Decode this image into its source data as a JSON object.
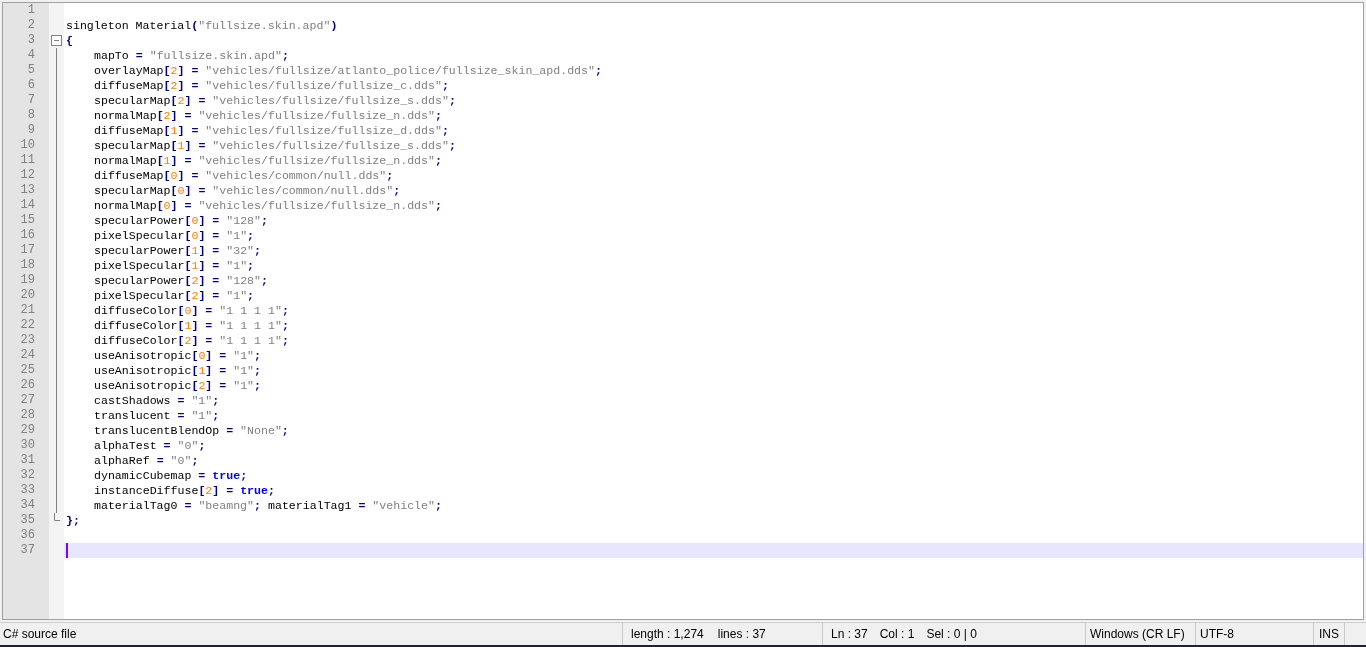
{
  "editor": {
    "lines": [
      {
        "number": "1",
        "kind": "plain",
        "current": false
      },
      {
        "number": "2",
        "kind": "plain",
        "current": false,
        "tokens": [
          {
            "kind": "ident",
            "text": "singleton Material"
          },
          {
            "kind": "op",
            "text": "("
          },
          {
            "kind": "str",
            "text": "\"fullsize.skin.apd\""
          },
          {
            "kind": "op",
            "text": ")"
          }
        ]
      },
      {
        "number": "3",
        "kind": "fold_start",
        "current": false,
        "tokens": [
          {
            "kind": "op",
            "text": "{"
          }
        ]
      },
      {
        "number": "4",
        "kind": "fold_body",
        "current": false,
        "tokens": [
          {
            "kind": "ident",
            "text": "mapTo"
          },
          {
            "kind": "op",
            "text": " = "
          },
          {
            "kind": "str",
            "text": "\"fullsize.skin.apd\""
          },
          {
            "kind": "op",
            "text": ";"
          }
        ]
      },
      {
        "number": "5",
        "kind": "fold_body",
        "current": false,
        "tokens": [
          {
            "kind": "ident",
            "text": "overlayMap"
          },
          {
            "kind": "op",
            "text": "["
          },
          {
            "kind": "num",
            "text": "2"
          },
          {
            "kind": "op",
            "text": "] = "
          },
          {
            "kind": "str",
            "text": "\"vehicles/fullsize/atlanto_police/fullsize_skin_apd.dds\""
          },
          {
            "kind": "op",
            "text": ";"
          }
        ]
      },
      {
        "number": "6",
        "kind": "fold_body",
        "current": false,
        "tokens": [
          {
            "kind": "ident",
            "text": "diffuseMap"
          },
          {
            "kind": "op",
            "text": "["
          },
          {
            "kind": "num",
            "text": "2"
          },
          {
            "kind": "op",
            "text": "] = "
          },
          {
            "kind": "str",
            "text": "\"vehicles/fullsize/fullsize_c.dds\""
          },
          {
            "kind": "op",
            "text": ";"
          }
        ]
      },
      {
        "number": "7",
        "kind": "fold_body",
        "current": false,
        "tokens": [
          {
            "kind": "ident",
            "text": "specularMap"
          },
          {
            "kind": "op",
            "text": "["
          },
          {
            "kind": "num",
            "text": "2"
          },
          {
            "kind": "op",
            "text": "] = "
          },
          {
            "kind": "str",
            "text": "\"vehicles/fullsize/fullsize_s.dds\""
          },
          {
            "kind": "op",
            "text": ";"
          }
        ]
      },
      {
        "number": "8",
        "kind": "fold_body",
        "current": false,
        "tokens": [
          {
            "kind": "ident",
            "text": "normalMap"
          },
          {
            "kind": "op",
            "text": "["
          },
          {
            "kind": "num",
            "text": "2"
          },
          {
            "kind": "op",
            "text": "] = "
          },
          {
            "kind": "str",
            "text": "\"vehicles/fullsize/fullsize_n.dds\""
          },
          {
            "kind": "op",
            "text": ";"
          }
        ]
      },
      {
        "number": "9",
        "kind": "fold_body",
        "current": false,
        "tokens": [
          {
            "kind": "ident",
            "text": "diffuseMap"
          },
          {
            "kind": "op",
            "text": "["
          },
          {
            "kind": "num",
            "text": "1"
          },
          {
            "kind": "op",
            "text": "] = "
          },
          {
            "kind": "str",
            "text": "\"vehicles/fullsize/fullsize_d.dds\""
          },
          {
            "kind": "op",
            "text": ";"
          }
        ]
      },
      {
        "number": "10",
        "kind": "fold_body",
        "current": false,
        "tokens": [
          {
            "kind": "ident",
            "text": "specularMap"
          },
          {
            "kind": "op",
            "text": "["
          },
          {
            "kind": "num",
            "text": "1"
          },
          {
            "kind": "op",
            "text": "] = "
          },
          {
            "kind": "str",
            "text": "\"vehicles/fullsize/fullsize_s.dds\""
          },
          {
            "kind": "op",
            "text": ";"
          }
        ]
      },
      {
        "number": "11",
        "kind": "fold_body",
        "current": false,
        "tokens": [
          {
            "kind": "ident",
            "text": "normalMap"
          },
          {
            "kind": "op",
            "text": "["
          },
          {
            "kind": "num",
            "text": "1"
          },
          {
            "kind": "op",
            "text": "] = "
          },
          {
            "kind": "str",
            "text": "\"vehicles/fullsize/fullsize_n.dds\""
          },
          {
            "kind": "op",
            "text": ";"
          }
        ]
      },
      {
        "number": "12",
        "kind": "fold_body",
        "current": false,
        "tokens": [
          {
            "kind": "ident",
            "text": "diffuseMap"
          },
          {
            "kind": "op",
            "text": "["
          },
          {
            "kind": "num",
            "text": "0"
          },
          {
            "kind": "op",
            "text": "] = "
          },
          {
            "kind": "str",
            "text": "\"vehicles/common/null.dds\""
          },
          {
            "kind": "op",
            "text": ";"
          }
        ]
      },
      {
        "number": "13",
        "kind": "fold_body",
        "current": false,
        "tokens": [
          {
            "kind": "ident",
            "text": "specularMap"
          },
          {
            "kind": "op",
            "text": "["
          },
          {
            "kind": "num",
            "text": "0"
          },
          {
            "kind": "op",
            "text": "] = "
          },
          {
            "kind": "str",
            "text": "\"vehicles/common/null.dds\""
          },
          {
            "kind": "op",
            "text": ";"
          }
        ]
      },
      {
        "number": "14",
        "kind": "fold_body",
        "current": false,
        "tokens": [
          {
            "kind": "ident",
            "text": "normalMap"
          },
          {
            "kind": "op",
            "text": "["
          },
          {
            "kind": "num",
            "text": "0"
          },
          {
            "kind": "op",
            "text": "] = "
          },
          {
            "kind": "str",
            "text": "\"vehicles/fullsize/fullsize_n.dds\""
          },
          {
            "kind": "op",
            "text": ";"
          }
        ]
      },
      {
        "number": "15",
        "kind": "fold_body",
        "current": false,
        "tokens": [
          {
            "kind": "ident",
            "text": "specularPower"
          },
          {
            "kind": "op",
            "text": "["
          },
          {
            "kind": "num",
            "text": "0"
          },
          {
            "kind": "op",
            "text": "] = "
          },
          {
            "kind": "str",
            "text": "\"128\""
          },
          {
            "kind": "op",
            "text": ";"
          }
        ]
      },
      {
        "number": "16",
        "kind": "fold_body",
        "current": false,
        "tokens": [
          {
            "kind": "ident",
            "text": "pixelSpecular"
          },
          {
            "kind": "op",
            "text": "["
          },
          {
            "kind": "num",
            "text": "0"
          },
          {
            "kind": "op",
            "text": "] = "
          },
          {
            "kind": "str",
            "text": "\"1\""
          },
          {
            "kind": "op",
            "text": ";"
          }
        ]
      },
      {
        "number": "17",
        "kind": "fold_body",
        "current": false,
        "tokens": [
          {
            "kind": "ident",
            "text": "specularPower"
          },
          {
            "kind": "op",
            "text": "["
          },
          {
            "kind": "num",
            "text": "1"
          },
          {
            "kind": "op",
            "text": "] = "
          },
          {
            "kind": "str",
            "text": "\"32\""
          },
          {
            "kind": "op",
            "text": ";"
          }
        ]
      },
      {
        "number": "18",
        "kind": "fold_body",
        "current": false,
        "tokens": [
          {
            "kind": "ident",
            "text": "pixelSpecular"
          },
          {
            "kind": "op",
            "text": "["
          },
          {
            "kind": "num",
            "text": "1"
          },
          {
            "kind": "op",
            "text": "] = "
          },
          {
            "kind": "str",
            "text": "\"1\""
          },
          {
            "kind": "op",
            "text": ";"
          }
        ]
      },
      {
        "number": "19",
        "kind": "fold_body",
        "current": false,
        "tokens": [
          {
            "kind": "ident",
            "text": "specularPower"
          },
          {
            "kind": "op",
            "text": "["
          },
          {
            "kind": "num",
            "text": "2"
          },
          {
            "kind": "op",
            "text": "] = "
          },
          {
            "kind": "str",
            "text": "\"128\""
          },
          {
            "kind": "op",
            "text": ";"
          }
        ]
      },
      {
        "number": "20",
        "kind": "fold_body",
        "current": false,
        "tokens": [
          {
            "kind": "ident",
            "text": "pixelSpecular"
          },
          {
            "kind": "op",
            "text": "["
          },
          {
            "kind": "num",
            "text": "2"
          },
          {
            "kind": "op",
            "text": "] = "
          },
          {
            "kind": "str",
            "text": "\"1\""
          },
          {
            "kind": "op",
            "text": ";"
          }
        ]
      },
      {
        "number": "21",
        "kind": "fold_body",
        "current": false,
        "tokens": [
          {
            "kind": "ident",
            "text": "diffuseColor"
          },
          {
            "kind": "op",
            "text": "["
          },
          {
            "kind": "num",
            "text": "0"
          },
          {
            "kind": "op",
            "text": "] = "
          },
          {
            "kind": "str",
            "text": "\"1 1 1 1\""
          },
          {
            "kind": "op",
            "text": ";"
          }
        ]
      },
      {
        "number": "22",
        "kind": "fold_body",
        "current": false,
        "tokens": [
          {
            "kind": "ident",
            "text": "diffuseColor"
          },
          {
            "kind": "op",
            "text": "["
          },
          {
            "kind": "num",
            "text": "1"
          },
          {
            "kind": "op",
            "text": "] = "
          },
          {
            "kind": "str",
            "text": "\"1 1 1 1\""
          },
          {
            "kind": "op",
            "text": ";"
          }
        ]
      },
      {
        "number": "23",
        "kind": "fold_body",
        "current": false,
        "tokens": [
          {
            "kind": "ident",
            "text": "diffuseColor"
          },
          {
            "kind": "op",
            "text": "["
          },
          {
            "kind": "num",
            "text": "2"
          },
          {
            "kind": "op",
            "text": "] = "
          },
          {
            "kind": "str",
            "text": "\"1 1 1 1\""
          },
          {
            "kind": "op",
            "text": ";"
          }
        ]
      },
      {
        "number": "24",
        "kind": "fold_body",
        "current": false,
        "tokens": [
          {
            "kind": "ident",
            "text": "useAnisotropic"
          },
          {
            "kind": "op",
            "text": "["
          },
          {
            "kind": "num",
            "text": "0"
          },
          {
            "kind": "op",
            "text": "] = "
          },
          {
            "kind": "str",
            "text": "\"1\""
          },
          {
            "kind": "op",
            "text": ";"
          }
        ]
      },
      {
        "number": "25",
        "kind": "fold_body",
        "current": false,
        "tokens": [
          {
            "kind": "ident",
            "text": "useAnisotropic"
          },
          {
            "kind": "op",
            "text": "["
          },
          {
            "kind": "num",
            "text": "1"
          },
          {
            "kind": "op",
            "text": "] = "
          },
          {
            "kind": "str",
            "text": "\"1\""
          },
          {
            "kind": "op",
            "text": ";"
          }
        ]
      },
      {
        "number": "26",
        "kind": "fold_body",
        "current": false,
        "tokens": [
          {
            "kind": "ident",
            "text": "useAnisotropic"
          },
          {
            "kind": "op",
            "text": "["
          },
          {
            "kind": "num",
            "text": "2"
          },
          {
            "kind": "op",
            "text": "] = "
          },
          {
            "kind": "str",
            "text": "\"1\""
          },
          {
            "kind": "op",
            "text": ";"
          }
        ]
      },
      {
        "number": "27",
        "kind": "fold_body",
        "current": false,
        "tokens": [
          {
            "kind": "ident",
            "text": "castShadows"
          },
          {
            "kind": "op",
            "text": " = "
          },
          {
            "kind": "str",
            "text": "\"1\""
          },
          {
            "kind": "op",
            "text": ";"
          }
        ]
      },
      {
        "number": "28",
        "kind": "fold_body",
        "current": false,
        "tokens": [
          {
            "kind": "ident",
            "text": "translucent"
          },
          {
            "kind": "op",
            "text": " = "
          },
          {
            "kind": "str",
            "text": "\"1\""
          },
          {
            "kind": "op",
            "text": ";"
          }
        ]
      },
      {
        "number": "29",
        "kind": "fold_body",
        "current": false,
        "tokens": [
          {
            "kind": "ident",
            "text": "translucentBlendOp"
          },
          {
            "kind": "op",
            "text": " = "
          },
          {
            "kind": "str",
            "text": "\"None\""
          },
          {
            "kind": "op",
            "text": ";"
          }
        ]
      },
      {
        "number": "30",
        "kind": "fold_body",
        "current": false,
        "tokens": [
          {
            "kind": "ident",
            "text": "alphaTest"
          },
          {
            "kind": "op",
            "text": " = "
          },
          {
            "kind": "str",
            "text": "\"0\""
          },
          {
            "kind": "op",
            "text": ";"
          }
        ]
      },
      {
        "number": "31",
        "kind": "fold_body",
        "current": false,
        "tokens": [
          {
            "kind": "ident",
            "text": "alphaRef"
          },
          {
            "kind": "op",
            "text": " = "
          },
          {
            "kind": "str",
            "text": "\"0\""
          },
          {
            "kind": "op",
            "text": ";"
          }
        ]
      },
      {
        "number": "32",
        "kind": "fold_body",
        "current": false,
        "tokens": [
          {
            "kind": "ident",
            "text": "dynamicCubemap"
          },
          {
            "kind": "op",
            "text": " = "
          },
          {
            "kind": "kw",
            "text": "true"
          },
          {
            "kind": "op",
            "text": ";"
          }
        ]
      },
      {
        "number": "33",
        "kind": "fold_body",
        "current": false,
        "tokens": [
          {
            "kind": "ident",
            "text": "instanceDiffuse"
          },
          {
            "kind": "op",
            "text": "["
          },
          {
            "kind": "num",
            "text": "2"
          },
          {
            "kind": "op",
            "text": "] = "
          },
          {
            "kind": "kw",
            "text": "true"
          },
          {
            "kind": "op",
            "text": ";"
          }
        ]
      },
      {
        "number": "34",
        "kind": "fold_body",
        "current": false,
        "tokens": [
          {
            "kind": "ident",
            "text": "materialTag0"
          },
          {
            "kind": "op",
            "text": " = "
          },
          {
            "kind": "str",
            "text": "\"beamng\""
          },
          {
            "kind": "op",
            "text": "; "
          },
          {
            "kind": "ident",
            "text": "materialTag1"
          },
          {
            "kind": "op",
            "text": " = "
          },
          {
            "kind": "str",
            "text": "\"vehicle\""
          },
          {
            "kind": "op",
            "text": ";"
          }
        ]
      },
      {
        "number": "35",
        "kind": "fold_end",
        "current": false,
        "tokens": [
          {
            "kind": "op",
            "text": "};"
          }
        ]
      },
      {
        "number": "36",
        "kind": "plain",
        "current": false
      },
      {
        "number": "37",
        "kind": "plain",
        "current": true
      }
    ]
  },
  "status_bar": {
    "file_type": "C# source file",
    "length": "length : 1,274",
    "lines": "lines : 37",
    "ln": "Ln : 37",
    "col": "Col : 1",
    "sel": "Sel : 0 | 0",
    "eol": "Windows (CR LF)",
    "encoding": "UTF-8",
    "mode": "INS"
  }
}
